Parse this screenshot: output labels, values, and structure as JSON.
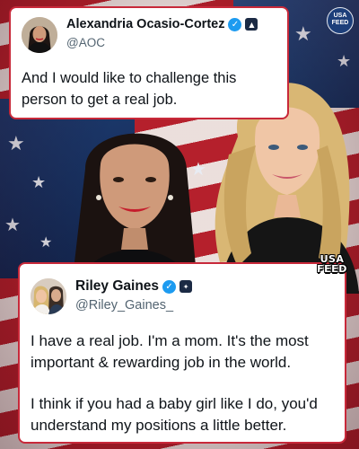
{
  "colors": {
    "card_border": "#c8293a",
    "verified_blue": "#1d9bf0",
    "handle_gray": "#536471",
    "text": "#0f1419"
  },
  "top_post": {
    "author_name": "Alexandria Ocasio-Cortez",
    "handle": "@AOC",
    "verified_icon": "verified-badge-icon",
    "affiliation_icon": "affiliation-badge-icon",
    "text": "And I would like to challenge this person to get a real job."
  },
  "bottom_post": {
    "author_name": "Riley Gaines",
    "handle": "@Riley_Gaines_",
    "verified_icon": "verified-badge-icon",
    "affiliation_icon": "affiliation-badge-icon",
    "paragraphs": [
      "I have a real job. I'm a mom. It's the most important & rewarding job in the world.",
      "I think if you had a baby girl like I do, you'd understand my positions a little better."
    ]
  },
  "branding": {
    "logo_top": "USA",
    "logo_bottom": "FEED",
    "watermark_top": "USA",
    "watermark_bottom": "FEED"
  }
}
